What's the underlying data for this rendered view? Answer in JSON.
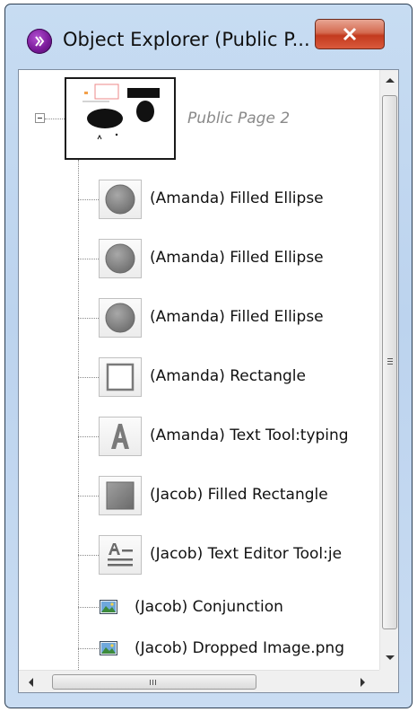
{
  "window": {
    "title": "Object Explorer (Public P...",
    "close_label": "x"
  },
  "tree": {
    "root": {
      "label": "Public Page 2",
      "expanded": true
    },
    "items": [
      {
        "label": "(Amanda) Filled Ellipse",
        "icon": "filled-ellipse-icon"
      },
      {
        "label": "(Amanda) Filled Ellipse",
        "icon": "filled-ellipse-icon"
      },
      {
        "label": "(Amanda) Filled Ellipse",
        "icon": "filled-ellipse-icon"
      },
      {
        "label": "(Amanda) Rectangle",
        "icon": "rectangle-icon"
      },
      {
        "label": "(Amanda) Text Tool:typing",
        "icon": "text-tool-icon"
      },
      {
        "label": "(Jacob) Filled Rectangle",
        "icon": "filled-rectangle-icon"
      },
      {
        "label": "(Jacob) Text Editor Tool:je",
        "icon": "text-editor-icon"
      }
    ],
    "small_items": [
      {
        "label": "(Jacob) Conjunction",
        "icon": "image-icon"
      },
      {
        "label": "(Jacob) Dropped Image.png",
        "icon": "image-icon"
      }
    ]
  },
  "scrollbars": {
    "vertical_icon": "scrollbar-grip-icon",
    "horizontal_icon": "scrollbar-grip-icon"
  },
  "colors": {
    "frame": "#c7dcf2",
    "close_button": "#c33a1e",
    "app_icon": "#7a1a9a"
  }
}
